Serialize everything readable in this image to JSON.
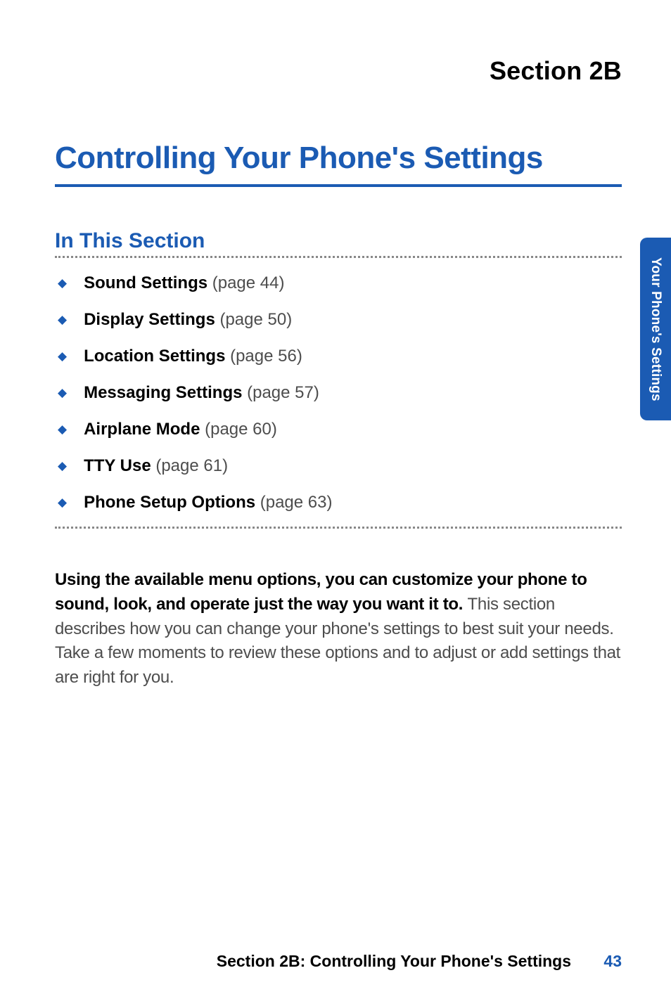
{
  "header": {
    "section_label": "Section 2B"
  },
  "title": "Controlling Your Phone's Settings",
  "subheading": "In This Section",
  "toc": [
    {
      "title": "Sound Settings",
      "page": " (page 44)"
    },
    {
      "title": "Display Settings",
      "page": " (page 50)"
    },
    {
      "title": "Location Settings",
      "page": " (page 56)"
    },
    {
      "title": "Messaging Settings",
      "page": " (page 57)"
    },
    {
      "title": "Airplane Mode",
      "page": " (page 60)"
    },
    {
      "title": "TTY Use",
      "page": " (page 61)"
    },
    {
      "title": "Phone Setup Options",
      "page": " (page 63)"
    }
  ],
  "body": {
    "lead": "Using the available menu options, you can customize your phone to sound, look, and operate just the way you want it to. ",
    "rest": "This section describes how you can change your phone's settings to best suit your needs. Take a few moments to review these options and to adjust or add settings that are right for you."
  },
  "side_tab": "Your Phone's Settings",
  "footer": {
    "section": "Section 2B: Controlling Your Phone's Settings",
    "page_number": "43"
  }
}
